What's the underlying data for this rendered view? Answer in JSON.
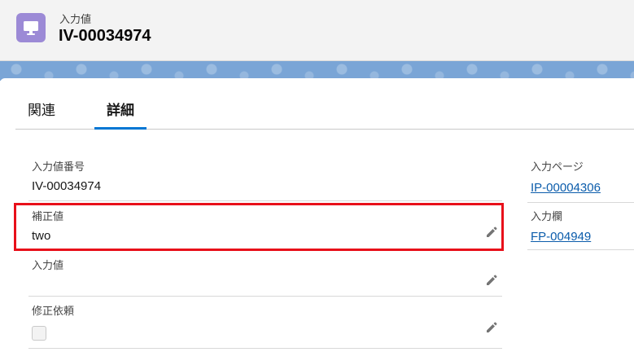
{
  "header": {
    "object_label": "入力値",
    "record_name": "IV-00034974",
    "icon": "desktop-icon",
    "icon_color": "#9c8ad6"
  },
  "tabs": [
    {
      "label": "関連",
      "active": false
    },
    {
      "label": "詳細",
      "active": true
    }
  ],
  "fields_left": {
    "iv_number": {
      "label": "入力値番号",
      "value": "IV-00034974"
    },
    "corrected_value": {
      "label": "補正値",
      "value": "two"
    },
    "input_value": {
      "label": "入力値",
      "value": ""
    },
    "correction_request": {
      "label": "修正依頼",
      "checked": false
    }
  },
  "fields_right": {
    "input_page": {
      "label": "入力ページ",
      "value": "IP-00004306"
    },
    "input_field": {
      "label": "入力欄",
      "value": "FP-004949"
    }
  },
  "colors": {
    "accent": "#0176d3",
    "link": "#0b5cab",
    "highlight": "#e8101a",
    "banner": "#7aa5d6"
  }
}
